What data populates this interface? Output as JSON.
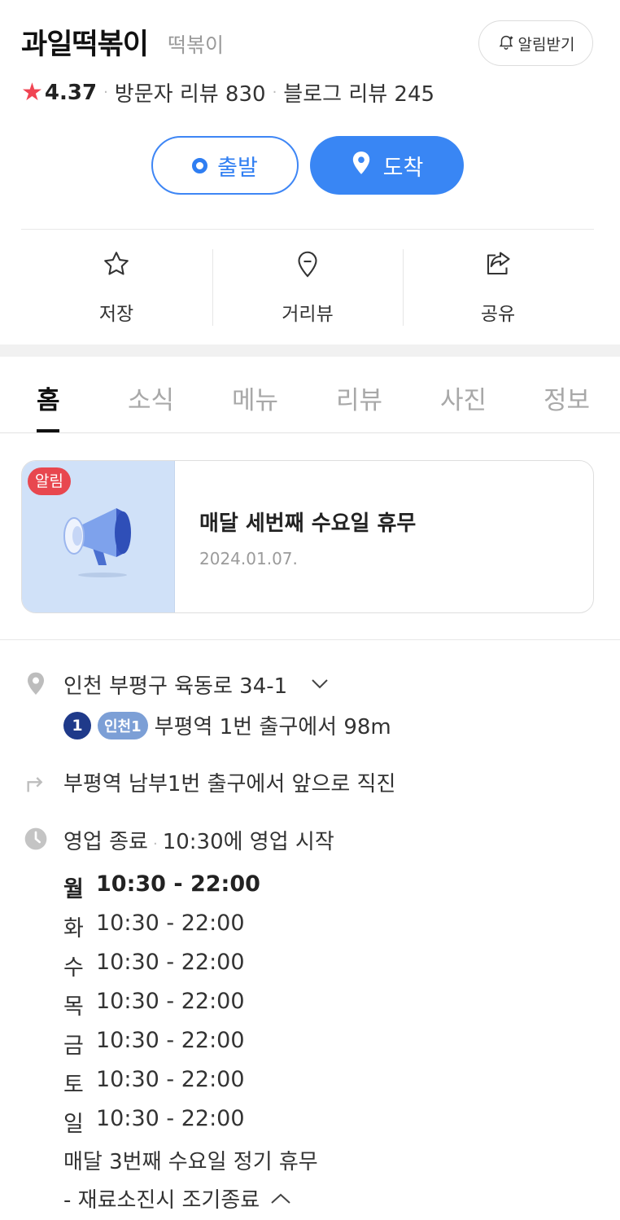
{
  "header": {
    "title": "과일떡볶이",
    "category": "떡볶이",
    "alarm_label": "알림받기",
    "rating_star": "★",
    "rating": "4.37",
    "visitor_reviews": "방문자 리뷰 830",
    "blog_reviews": "블로그 리뷰 245",
    "dot": "·"
  },
  "directions": {
    "depart_label": "출발",
    "arrive_label": "도착"
  },
  "actions": [
    {
      "label": "저장",
      "icon": "star-outline-icon"
    },
    {
      "label": "거리뷰",
      "icon": "map-pin-outline-icon"
    },
    {
      "label": "공유",
      "icon": "share-icon"
    }
  ],
  "tabs": [
    {
      "label": "홈",
      "active": true
    },
    {
      "label": "소식"
    },
    {
      "label": "메뉴"
    },
    {
      "label": "리뷰"
    },
    {
      "label": "사진"
    },
    {
      "label": "정보"
    }
  ],
  "notice": {
    "badge": "알림",
    "title": "매달 세번째 수요일 휴무",
    "date": "2024.01.07.",
    "icon": "megaphone-icon"
  },
  "info": {
    "address": "인천 부평구 육동로 34-1",
    "subway_line": "1",
    "subway_line2": "인천1",
    "subway_text": "부평역 1번 출구에서 98m",
    "directions_text": "부평역 남부1번 출구에서 앞으로 직진",
    "status": "영업 종료",
    "status_dot": "·",
    "status_detail": "10:30에 영업 시작",
    "hours": [
      {
        "day": "월",
        "time": "10:30 - 22:00",
        "today": true
      },
      {
        "day": "화",
        "time": "10:30 - 22:00"
      },
      {
        "day": "수",
        "time": "10:30 - 22:00"
      },
      {
        "day": "목",
        "time": "10:30 - 22:00"
      },
      {
        "day": "금",
        "time": "10:30 - 22:00"
      },
      {
        "day": "토",
        "time": "10:30 - 22:00"
      },
      {
        "day": "일",
        "time": "10:30 - 22:00"
      }
    ],
    "note1": "매달 3번째 수요일 정기 휴무",
    "note2": "- 재료소진시 조기종료"
  },
  "colors": {
    "accent": "#3986f4",
    "badge_red": "#e8474f",
    "star_red": "#f04452"
  }
}
